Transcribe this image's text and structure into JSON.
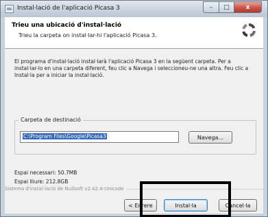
{
  "window": {
    "title": "Instal·lació de l'aplicació Picasa 3",
    "minimize_glyph": "–",
    "maximize_glyph": "□",
    "close_glyph": "x"
  },
  "header": {
    "title": "Trieu una ubicació d'instal·lació",
    "subtitle": "Trieu la carpeta on instal·lar-hi l'aplicació Picasa 3.",
    "logo_icon": "picasa-logo-icon"
  },
  "body": {
    "instructions": "El programa d'instal·lació instal·larà l'aplicació Picasa 3 en la següent carpeta. Per a instal·lar-lo en una carpeta diferent, feu clic a Navega i seleccioneu-ne una altra. Feu clic a Instal·la per a iniciar la instal·lació."
  },
  "destination": {
    "group_label": "Carpeta de destinació",
    "path_value": "C:\\Program Files\\Google\\Picasa3",
    "browse_label": "Navega..."
  },
  "space": {
    "required": "Espai necessari: 50.7MB",
    "free": "Espai lliure: 212.8GB"
  },
  "footer": {
    "installer_text": "Sistema d'instal·lació de Nullsoft v2.42.4-Unicode",
    "back_label": "< Enrere",
    "install_label": "Instal·la",
    "cancel_label": "Cancel·la"
  },
  "colors": {
    "highlight_border": "#000000",
    "selection": "#3568b6",
    "close_button": "#c8544a"
  }
}
